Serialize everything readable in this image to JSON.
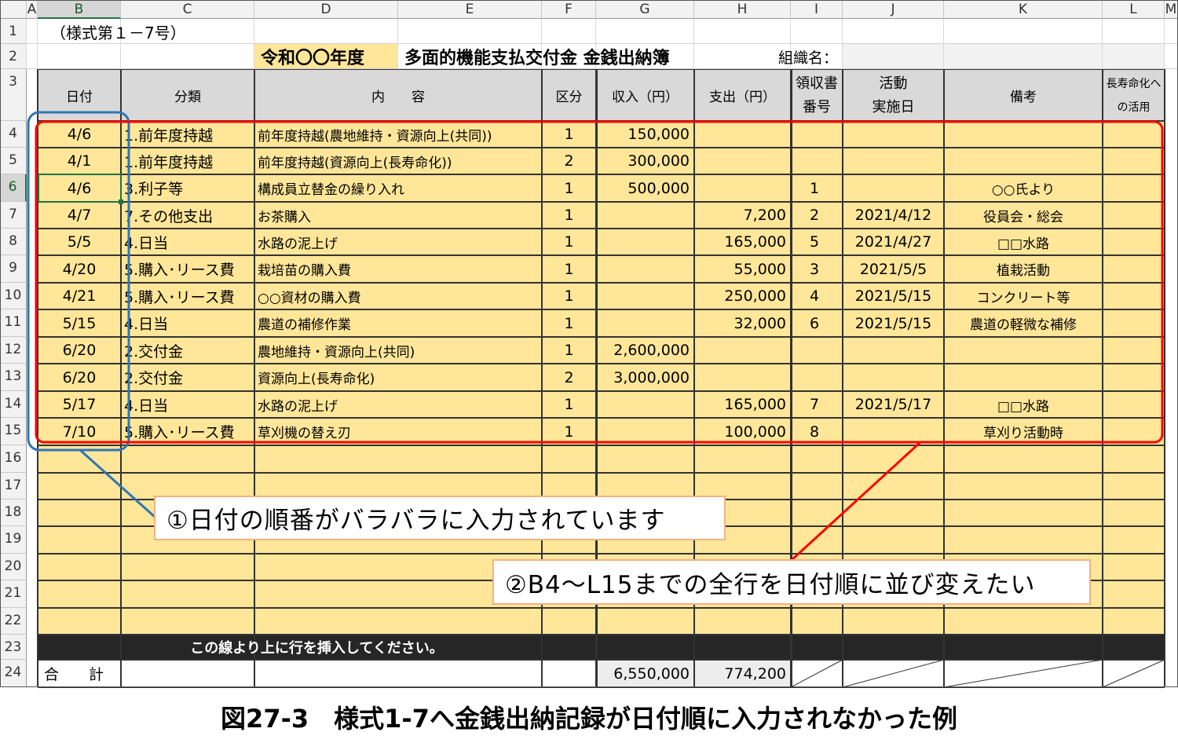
{
  "spreadsheet": {
    "column_headers": [
      "A",
      "B",
      "C",
      "D",
      "E",
      "F",
      "G",
      "H",
      "I",
      "J",
      "K",
      "L",
      "M"
    ],
    "selected_column": "B",
    "selected_row": "6",
    "row_numbers": [
      "1",
      "2",
      "3",
      "4",
      "5",
      "6",
      "7",
      "8",
      "9",
      "10",
      "11",
      "12",
      "13",
      "14",
      "15",
      "16",
      "17",
      "18",
      "19",
      "20",
      "21",
      "22",
      "23",
      "24"
    ],
    "form_number": "（様式第１－7号）",
    "title_year": "令和〇〇年度",
    "title_main": "多面的機能支払交付金 金銭出納簿",
    "org_label": "組織名：",
    "headers": {
      "date": "日付",
      "category": "分類",
      "content": "内　　容",
      "division": "区分",
      "income": "収入（円）",
      "expense": "支出（円）",
      "receipt_1": "領収書",
      "receipt_2": "番号",
      "activity_1": "活動",
      "activity_2": "実施日",
      "remarks": "備考",
      "longevity_1": "長寿命化へ",
      "longevity_2": "の活用"
    },
    "rows": [
      {
        "date": "4/6",
        "category": "1.前年度持越",
        "content": "前年度持越(農地維持・資源向上(共同))",
        "division": "1",
        "income": "150,000",
        "expense": "",
        "receipt": "",
        "activity": "",
        "remarks": ""
      },
      {
        "date": "4/1",
        "category": "1.前年度持越",
        "content": "前年度持越(資源向上(長寿命化))",
        "division": "2",
        "income": "300,000",
        "expense": "",
        "receipt": "",
        "activity": "",
        "remarks": ""
      },
      {
        "date": "4/6",
        "category": "3.利子等",
        "content": "構成員立替金の繰り入れ",
        "division": "1",
        "income": "500,000",
        "expense": "",
        "receipt": "1",
        "activity": "",
        "remarks": "○○氏より"
      },
      {
        "date": "4/7",
        "category": "7.その他支出",
        "content": "お茶購入",
        "division": "1",
        "income": "",
        "expense": "7,200",
        "receipt": "2",
        "activity": "2021/4/12",
        "remarks": "役員会・総会"
      },
      {
        "date": "5/5",
        "category": "4.日当",
        "content": "水路の泥上げ",
        "division": "1",
        "income": "",
        "expense": "165,000",
        "receipt": "5",
        "activity": "2021/4/27",
        "remarks": "□□水路"
      },
      {
        "date": "4/20",
        "category": "5.購入･リース費",
        "content": "栽培苗の購入費",
        "division": "1",
        "income": "",
        "expense": "55,000",
        "receipt": "3",
        "activity": "2021/5/5",
        "remarks": "植栽活動"
      },
      {
        "date": "4/21",
        "category": "5.購入･リース費",
        "content": "○○資材の購入費",
        "division": "1",
        "income": "",
        "expense": "250,000",
        "receipt": "4",
        "activity": "2021/5/15",
        "remarks": "コンクリート等"
      },
      {
        "date": "5/15",
        "category": "4.日当",
        "content": "農道の補修作業",
        "division": "1",
        "income": "",
        "expense": "32,000",
        "receipt": "6",
        "activity": "2021/5/15",
        "remarks": "農道の軽微な補修"
      },
      {
        "date": "6/20",
        "category": "2.交付金",
        "content": "農地維持・資源向上(共同)",
        "division": "1",
        "income": "2,600,000",
        "expense": "",
        "receipt": "",
        "activity": "",
        "remarks": ""
      },
      {
        "date": "6/20",
        "category": "2.交付金",
        "content": "資源向上(長寿命化)",
        "division": "2",
        "income": "3,000,000",
        "expense": "",
        "receipt": "",
        "activity": "",
        "remarks": ""
      },
      {
        "date": "5/17",
        "category": "4.日当",
        "content": "水路の泥上げ",
        "division": "1",
        "income": "",
        "expense": "165,000",
        "receipt": "7",
        "activity": "2021/5/17",
        "remarks": "□□水路"
      },
      {
        "date": "7/10",
        "category": "5.購入･リース費",
        "content": "草刈機の替え刃",
        "division": "1",
        "income": "",
        "expense": "100,000",
        "receipt": "8",
        "activity": "",
        "remarks": "草刈り活動時"
      }
    ],
    "insert_note": "この線より上に行を挿入してください。",
    "total_label": "合　　計",
    "total_income": "6,550,000",
    "total_expense": "774,200"
  },
  "callouts": {
    "date_order": "①日付の順番がバラバラに入力されています",
    "sort_rows": "②B4～L15までの全行を日付順に並び変えたい"
  },
  "colors": {
    "data_fill": "#ffe699",
    "header_fill": "#d9d9d9",
    "dark_band": "#262626",
    "blue_outline": "#2e75b6",
    "red_outline": "#ff0000",
    "callout_border": "#f4b183"
  },
  "caption": "図27-3　様式1-7へ金銭出納記録が日付順に入力されなかった例"
}
